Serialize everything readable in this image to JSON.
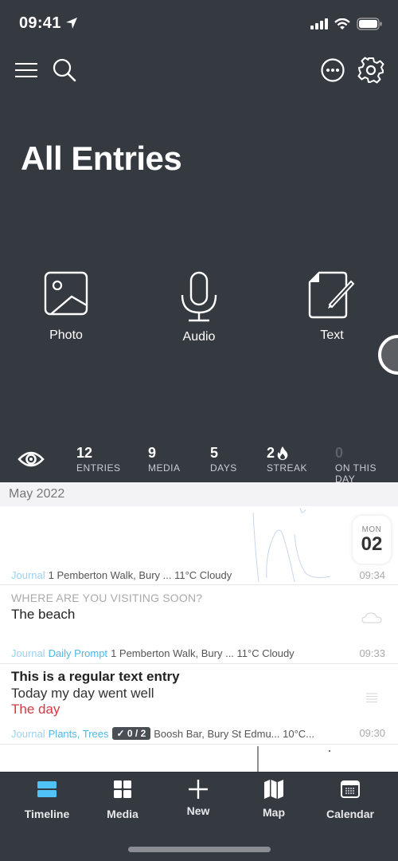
{
  "status_bar": {
    "time": "09:41",
    "location_icon": "location-arrow-icon",
    "signal_icon": "cellular-signal-icon",
    "wifi_icon": "wifi-icon",
    "battery_icon": "battery-icon"
  },
  "toolbar": {
    "menu_icon": "hamburger-menu-icon",
    "search_icon": "search-icon",
    "more_icon": "more-options-icon",
    "settings_icon": "gear-icon"
  },
  "header": {
    "title": "All Entries"
  },
  "quick_actions": [
    {
      "label": "Photo",
      "icon": "photo-icon"
    },
    {
      "label": "Audio",
      "icon": "microphone-icon"
    },
    {
      "label": "Text",
      "icon": "text-edit-icon"
    }
  ],
  "stats": {
    "eye_icon": "eye-icon",
    "items": [
      {
        "value": "12",
        "caption": "ENTRIES"
      },
      {
        "value": "9",
        "caption": "MEDIA"
      },
      {
        "value": "5",
        "caption": "DAYS"
      },
      {
        "value": "2",
        "caption": "STREAK",
        "icon": "flame-icon"
      },
      {
        "value": "0",
        "caption": "ON THIS DAY"
      }
    ]
  },
  "timeline": {
    "month": "May 2022",
    "date_badge": {
      "weekday": "MON",
      "day": "02"
    },
    "entries": [
      {
        "type": "drawing",
        "journal": "Journal",
        "location_weather": "1 Pemberton Walk, Bury ... 11°C Cloudy",
        "time": "09:34"
      },
      {
        "type": "prompt",
        "question": "WHERE ARE YOU VISITING SOON?",
        "answer": "The beach",
        "journal": "Journal",
        "tags": "Daily Prompt",
        "location_weather": "1 Pemberton Walk, Bury ... 11°C Cloudy",
        "time": "09:33",
        "side_icon": "cloud-icon"
      },
      {
        "type": "text",
        "title": "This is a regular text entry",
        "body": "Today my day went well",
        "highlight": "The day",
        "journal": "Journal",
        "tags": "Plants, Trees",
        "checklist": "✓ 0 / 2",
        "location_weather": "Boosh Bar, Bury St Edmu... 10°C...",
        "time": "09:30",
        "side_icon": "text-lines-icon"
      }
    ]
  },
  "tab_bar": {
    "active_color": "#4fc3f7",
    "tabs": [
      {
        "label": "Timeline",
        "icon": "timeline-icon",
        "active": true
      },
      {
        "label": "Media",
        "icon": "grid-icon"
      },
      {
        "label": "New",
        "icon": "plus-icon"
      },
      {
        "label": "Map",
        "icon": "map-icon"
      },
      {
        "label": "Calendar",
        "icon": "calendar-icon"
      }
    ]
  }
}
